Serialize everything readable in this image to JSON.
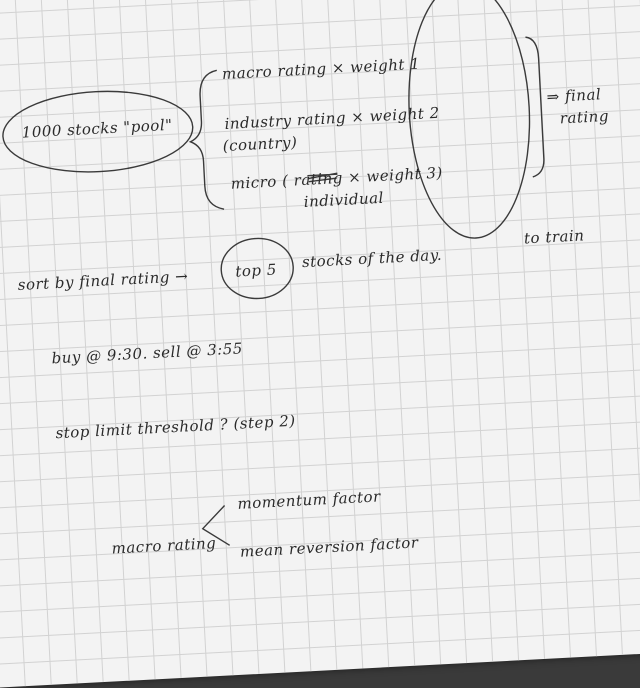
{
  "notes": {
    "pool": "1000 stocks \"pool\"",
    "macro_line": "macro rating   ×  weight 1",
    "industry_line": "industry rating  ×  weight 2",
    "industry_sub": "(country)",
    "micro_line": "micro (       rating  × weight 3)",
    "micro_sub": "individual",
    "final": "⇒ final",
    "final2": "rating",
    "sort_line": "sort by final rating  →",
    "top5": "top 5",
    "sort_rest": "stocks of the day.",
    "to_train": "to train",
    "buy_sell": "buy @ 9:30.   sell @ 3:55",
    "stop_line": "stop limit threshold ?  (step 2)",
    "macro_rating": "macro rating",
    "momentum": "momentum factor",
    "mean_rev": "mean reversion factor"
  }
}
